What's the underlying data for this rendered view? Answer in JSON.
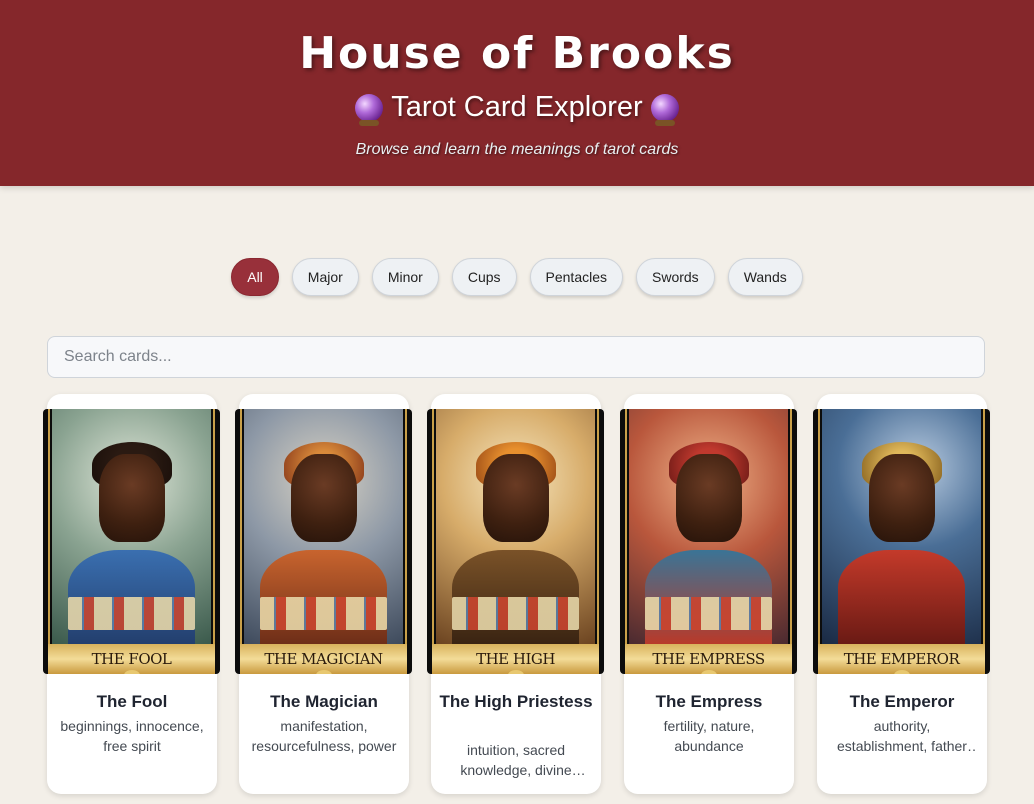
{
  "header": {
    "title": "House of Brooks",
    "subtitle": "Tarot Card Explorer",
    "tagline": "Browse and learn the meanings of tarot cards",
    "background_color": "#85272b",
    "icon": "crystal-ball-icon"
  },
  "filters": [
    {
      "label": "All",
      "active": true
    },
    {
      "label": "Major",
      "active": false
    },
    {
      "label": "Minor",
      "active": false
    },
    {
      "label": "Cups",
      "active": false
    },
    {
      "label": "Pentacles",
      "active": false
    },
    {
      "label": "Swords",
      "active": false
    },
    {
      "label": "Wands",
      "active": false
    }
  ],
  "search": {
    "placeholder": "Search cards...",
    "value": ""
  },
  "cards": [
    {
      "banner": "THE FOOL",
      "name": "The Fool",
      "keywords": "beginnings, innocence, free spirit",
      "palette": {
        "sky": "#6b8a7a",
        "head": "#2a1a12",
        "robe": "#2f5f9c"
      }
    },
    {
      "banner": "THE MAGICIAN",
      "name": "The Magician",
      "keywords": "manifestation, resourcefulness, power",
      "palette": {
        "sky": "#8fa0b4",
        "head": "#c06a2a",
        "robe": "#b8542a"
      }
    },
    {
      "banner": "THE HIGH PRIESTESS",
      "name": "The High Priestess",
      "keywords": "intuition, sacred knowledge, divine feminine",
      "palette": {
        "sky": "#d9b37a",
        "head": "#d07a28",
        "robe": "#5b3a1e"
      }
    },
    {
      "banner": "THE EMPRESS",
      "name": "The Empress",
      "keywords": "fertility, nature, abundance",
      "palette": {
        "sky": "#c46a4e",
        "head": "#b0302a",
        "robe": "#3a6f8f"
      }
    },
    {
      "banner": "THE EMPEROR",
      "name": "The Emperor",
      "keywords": "authority, establishment, father figure",
      "palette": {
        "sky": "#2d4a6e",
        "head": "#c99a3e",
        "robe": "#b8382a"
      }
    }
  ],
  "colors": {
    "accent": "#98303a",
    "page_background": "#f3efe8",
    "card_background": "#ffffff"
  }
}
